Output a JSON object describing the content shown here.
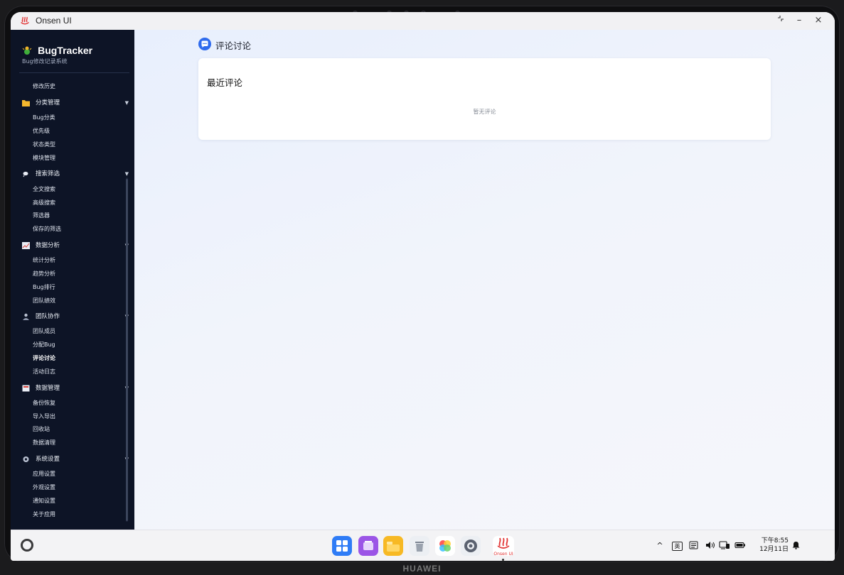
{
  "window": {
    "title": "Onsen UI"
  },
  "sidebar": {
    "brand_name": "BugTracker",
    "brand_sub": "Bug修改记录系统",
    "top_items": [
      "修改历史"
    ],
    "groups": [
      {
        "label": "分类管理",
        "icon": "folder-icon",
        "items": [
          "Bug分类",
          "优先级",
          "状态类型",
          "模块管理"
        ]
      },
      {
        "label": "搜索筛选",
        "icon": "search-icon",
        "items": [
          "全文搜索",
          "高级搜索",
          "筛选器",
          "保存的筛选"
        ]
      },
      {
        "label": "数据分析",
        "icon": "chart-icon",
        "items": [
          "统计分析",
          "趋势分析",
          "Bug排行",
          "团队绩效"
        ]
      },
      {
        "label": "团队协作",
        "icon": "team-icon",
        "items": [
          "团队成员",
          "分配Bug",
          "评论讨论",
          "活动日志"
        ]
      },
      {
        "label": "数据管理",
        "icon": "database-icon",
        "items": [
          "备份恢复",
          "导入导出",
          "回收站",
          "数据清理"
        ]
      },
      {
        "label": "系统设置",
        "icon": "gear-icon",
        "items": [
          "应用设置",
          "外观设置",
          "通知设置",
          "关于应用"
        ]
      }
    ],
    "active_item": "评论讨论"
  },
  "main": {
    "page_title": "评论讨论",
    "card_title": "最近评论",
    "empty_text": "暂无评论"
  },
  "taskbar": {
    "dock_apps": [
      "app-grid-icon",
      "multitask-icon",
      "files-icon",
      "trash-icon",
      "gallery-icon",
      "settings-icon",
      "onsen-ui-icon"
    ],
    "dock_label": "Onsen UI",
    "ime_label": "英",
    "time": "下午8:55",
    "date": "12月11日"
  },
  "device": {
    "brand": "HUAWEI"
  },
  "colors": {
    "sidebar_bg": "#0d1426",
    "accent": "#2f6bed",
    "main_bg": "#eef2fb"
  }
}
